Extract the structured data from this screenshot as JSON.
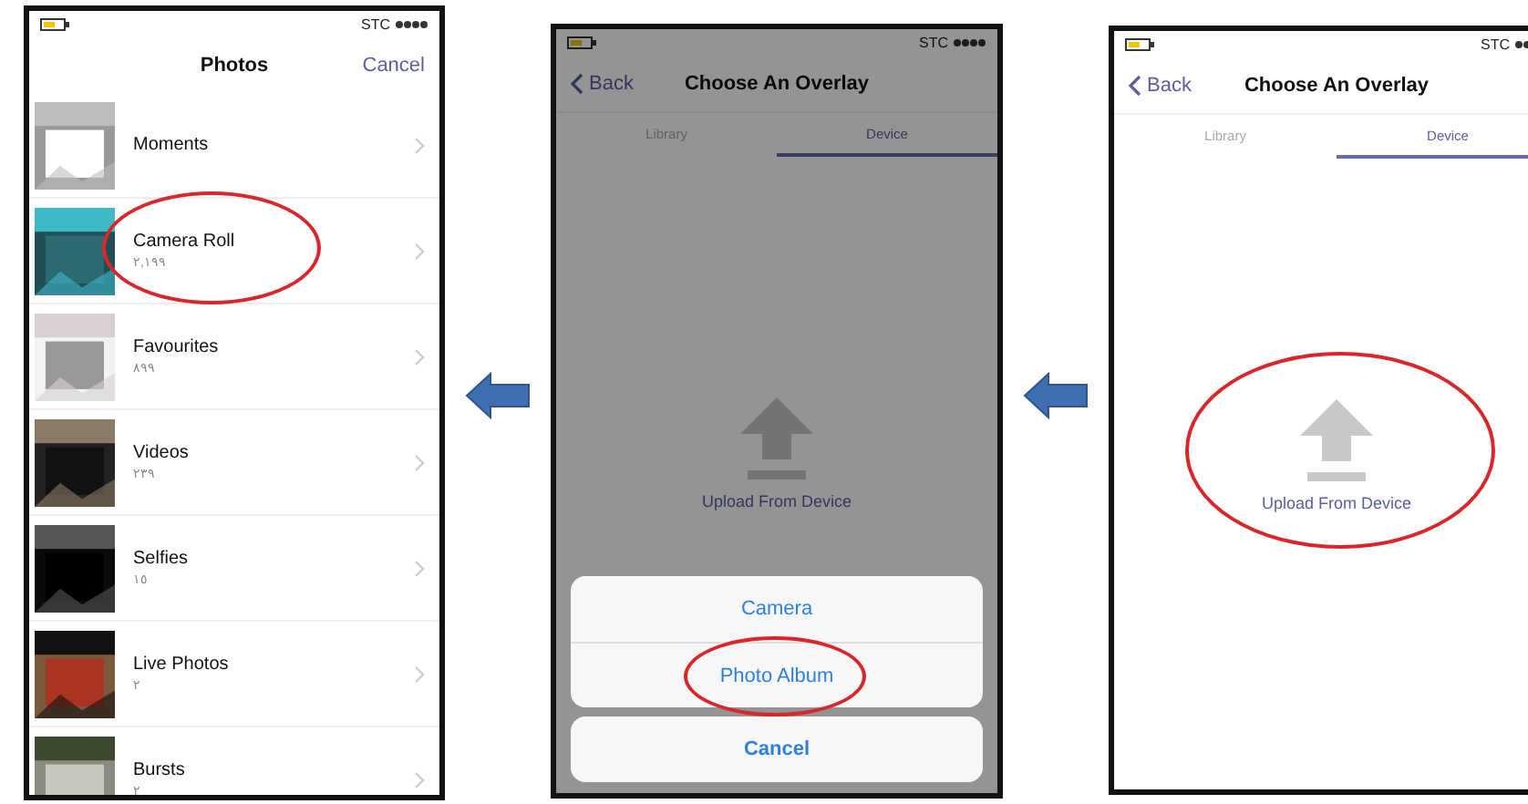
{
  "screens": [
    {
      "kind": "album_list",
      "status_bar": {
        "carrier": "STC"
      },
      "title": "Photos",
      "action": "Cancel",
      "albums": [
        {
          "name": "Moments",
          "circled": false
        },
        {
          "name": "Camera Roll",
          "count": "٢,١٩٩",
          "circled": true
        },
        {
          "name": "Favourites",
          "count": "٨٩٩",
          "circled": false
        },
        {
          "name": "Videos",
          "count": "٢٣٩",
          "circled": false
        },
        {
          "name": "Selfies",
          "count": "١٥",
          "circled": false
        },
        {
          "name": "Live Photos",
          "count": "٢",
          "circled": false
        },
        {
          "name": "Bursts",
          "count": "٢",
          "circled": false
        }
      ]
    },
    {
      "kind": "overlay_picker",
      "dimmed": true,
      "status_bar": {
        "carrier": "STC"
      },
      "back": "Back",
      "title": "Choose An Overlay",
      "tabs": [
        {
          "label": "Library",
          "selected": false
        },
        {
          "label": "Device",
          "selected": true
        }
      ],
      "upload_label": "Upload From Device",
      "upload_circled": false,
      "action_sheet": {
        "options": [
          {
            "label": "Camera",
            "circled": false
          },
          {
            "label": "Photo Album",
            "circled": true
          }
        ],
        "cancel": "Cancel"
      }
    },
    {
      "kind": "overlay_picker",
      "dimmed": false,
      "status_bar": {
        "carrier": "STC"
      },
      "back": "Back",
      "title": "Choose An Overlay",
      "tabs": [
        {
          "label": "Library",
          "selected": false
        },
        {
          "label": "Device",
          "selected": true
        }
      ],
      "upload_label": "Upload From Device",
      "upload_circled": true
    }
  ]
}
